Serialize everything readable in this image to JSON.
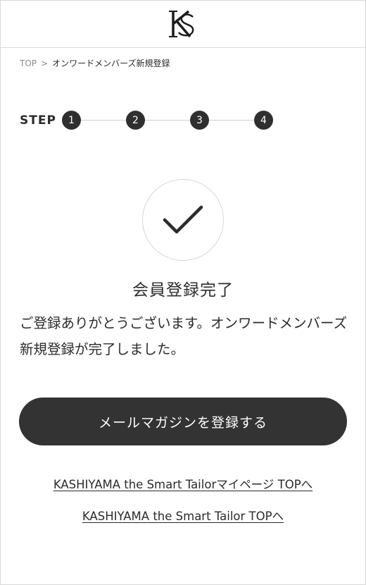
{
  "header": {
    "logo_text": "K"
  },
  "breadcrumb": {
    "top_label": "TOP",
    "separator": ">",
    "current_label": "オンワードメンバーズ新規登録"
  },
  "steps": {
    "label": "STEP",
    "items": [
      "1",
      "2",
      "3",
      "4"
    ],
    "current": 4
  },
  "completion": {
    "title": "会員登録完了",
    "message": "ご登録ありがとうございます。オンワードメンバーズ新規登録が完了しました。"
  },
  "actions": {
    "newsletter_button": "メールマガジンを登録する",
    "mypage_link": "KASHIYAMA the Smart Tailorマイページ TOPへ",
    "site_top_link": "KASHIYAMA the Smart Tailor TOPへ"
  },
  "colors": {
    "primary_button": "#333333",
    "step_dot": "#2f2f2f",
    "divider": "#dcdcdc"
  }
}
